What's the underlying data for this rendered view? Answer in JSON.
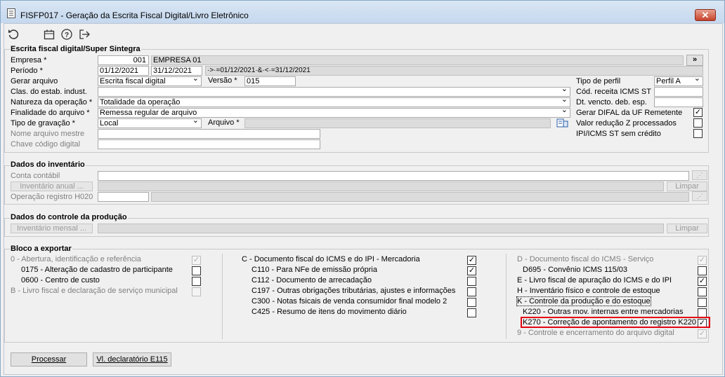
{
  "window": {
    "title": "FISFP017 - Geração da Escrita Fiscal Digital/Livro Eletrônico",
    "close": "✕"
  },
  "toolbar": {
    "icons": [
      "undo-icon",
      "calendar-icon",
      "help-icon",
      "exit-icon"
    ]
  },
  "escrita": {
    "title": "Escrita fiscal digital/Super Sintegra",
    "empresa_label": "Empresa *",
    "empresa_code": "001",
    "empresa_name": "EMPRESA 01",
    "more_button": "»",
    "periodo_label": "Período *",
    "periodo_start": "01/12/2021",
    "periodo_end": "31/12/2021",
    "periodo_expr": "·>·=01/12/2021·&·<·=31/12/2021",
    "gerar_label": "Gerar arquivo",
    "gerar_value": "Escrita fiscal digital",
    "versao_label": "Versão *",
    "versao_value": "015",
    "clas_label": "Clas. do estab. indust.",
    "clas_value": "",
    "natureza_label": "Natureza da operação *",
    "natureza_value": "Totalidade da operação",
    "finalidade_label": "Finalidade do arquivo *",
    "finalidade_value": "Remessa regular de arquivo",
    "tipo_grav_label": "Tipo de gravação *",
    "tipo_grav_value": "Local",
    "arquivo_label": "Arquivo *",
    "arquivo_value": "",
    "nome_mestre_label": "Nome arquivo mestre",
    "chave_label": "Chave código digital",
    "tipo_perfil_label": "Tipo de perfil",
    "tipo_perfil_value": "Perfil A",
    "cod_receita_label": "Cód. receita ICMS ST",
    "dt_vencto_label": "Dt. vencto. deb. esp.",
    "gerar_difal_label": "Gerar DIFAL da UF Remetente",
    "gerar_difal_checked": true,
    "valor_reducao_label": "Valor redução Z processados",
    "valor_reducao_checked": false,
    "ipi_icms_label": "IPI/ICMS ST sem crédito",
    "ipi_icms_checked": false
  },
  "inventario": {
    "title": "Dados do inventário",
    "conta_label": "Conta contábil",
    "inv_anual_button": "Inventário anual ...",
    "limpar_button": "Limpar",
    "op_h020_label": "Operação registro H020"
  },
  "producao": {
    "title": "Dados do controle da produção",
    "inv_mensal_button": "Inventário mensal ...",
    "limpar_button": "Limpar"
  },
  "bloco": {
    "title": "Bloco a exportar",
    "col1": [
      {
        "label": "0 - Abertura, identificação e referência",
        "checked": true,
        "disabled": true,
        "indent": false
      },
      {
        "label": "0175 - Alteração de cadastro de participante",
        "checked": false,
        "disabled": false,
        "indent": true
      },
      {
        "label": "0600 - Centro de custo",
        "checked": false,
        "disabled": false,
        "indent": true
      },
      {
        "label": "B - Livro fiscal e declaração de serviço municipal",
        "checked": false,
        "disabled": true,
        "indent": false
      }
    ],
    "col2": [
      {
        "label": "C - Documento fiscal do ICMS e do IPI - Mercadoria",
        "checked": true,
        "disabled": false,
        "indent": false
      },
      {
        "label": "C110 - Para NFe de emissão própria",
        "checked": true,
        "disabled": false,
        "indent": true
      },
      {
        "label": "C112 - Documento de arrecadação",
        "checked": false,
        "disabled": false,
        "indent": true
      },
      {
        "label": "C197 - Outras obrigações tributárias, ajustes e informações",
        "checked": false,
        "disabled": false,
        "indent": true
      },
      {
        "label": "C300 - Notas fsicais de venda consumidor final modelo 2",
        "checked": false,
        "disabled": false,
        "indent": true
      },
      {
        "label": "C425 - Resumo de itens do movimento diário",
        "checked": false,
        "disabled": false,
        "indent": true
      }
    ],
    "col3": [
      {
        "label": "D - Documento fiscal do ICMS - Serviço",
        "checked": true,
        "disabled": true,
        "indent": false
      },
      {
        "label": "D695 - Convênio ICMS 115/03",
        "checked": false,
        "disabled": false,
        "indent": true
      },
      {
        "label": "E - Livro fiscal de apuração do ICMS e do IPI",
        "checked": true,
        "disabled": false,
        "indent": false
      },
      {
        "label": "H - Inventário físico e controle de estoque",
        "checked": false,
        "disabled": false,
        "indent": false
      },
      {
        "label": "K - Controle da produção e do estoque",
        "checked": false,
        "disabled": false,
        "indent": false
      },
      {
        "label": "K220 - Outras mov. internas entre mercadorias",
        "checked": false,
        "disabled": false,
        "indent": true
      },
      {
        "label": "K270 - Correção de apontamento do registro K220",
        "checked": true,
        "disabled": false,
        "indent": true
      },
      {
        "label": "9 - Controle e encerramento do arquivo digital",
        "checked": true,
        "disabled": true,
        "indent": false
      }
    ]
  },
  "footer": {
    "processar": "Processar",
    "vl_declaratorio": "Vl. declaratório E115"
  },
  "colors": {
    "highlight": "#e30613",
    "title_bar": "#c5d8ee"
  }
}
